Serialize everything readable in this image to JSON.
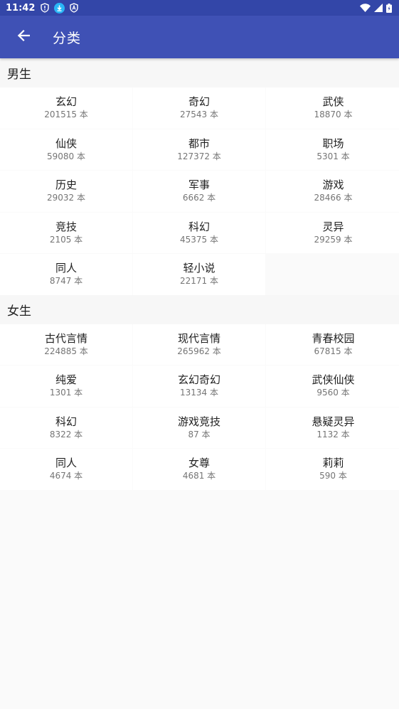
{
  "status_bar": {
    "time": "11:42",
    "left_icons": [
      "shield-alert-icon",
      "download-icon",
      "shield-a-icon"
    ],
    "right_icons": [
      "wifi-icon",
      "signal-icon",
      "battery-icon"
    ]
  },
  "app_bar": {
    "title": "分类",
    "back_icon": "arrow-left-icon",
    "color": "#3f51b5"
  },
  "sections": [
    {
      "title": "男生",
      "items": [
        {
          "name": "玄幻",
          "count": "201515 本"
        },
        {
          "name": "奇幻",
          "count": "27543 本"
        },
        {
          "name": "武侠",
          "count": "18870 本"
        },
        {
          "name": "仙侠",
          "count": "59080 本"
        },
        {
          "name": "都市",
          "count": "127372 本"
        },
        {
          "name": "职场",
          "count": "5301 本"
        },
        {
          "name": "历史",
          "count": "29032 本"
        },
        {
          "name": "军事",
          "count": "6662 本"
        },
        {
          "name": "游戏",
          "count": "28466 本"
        },
        {
          "name": "竞技",
          "count": "2105 本"
        },
        {
          "name": "科幻",
          "count": "45375 本"
        },
        {
          "name": "灵异",
          "count": "29259 本"
        },
        {
          "name": "同人",
          "count": "8747 本"
        },
        {
          "name": "轻小说",
          "count": "22171 本"
        }
      ]
    },
    {
      "title": "女生",
      "items": [
        {
          "name": "古代言情",
          "count": "224885 本"
        },
        {
          "name": "现代言情",
          "count": "265962 本"
        },
        {
          "name": "青春校园",
          "count": "67815 本"
        },
        {
          "name": "纯爱",
          "count": "1301 本"
        },
        {
          "name": "玄幻奇幻",
          "count": "13134 本"
        },
        {
          "name": "武侠仙侠",
          "count": "9560 本"
        },
        {
          "name": "科幻",
          "count": "8322 本"
        },
        {
          "name": "游戏竞技",
          "count": "87 本"
        },
        {
          "name": "悬疑灵异",
          "count": "1132 本"
        },
        {
          "name": "同人",
          "count": "4674 本"
        },
        {
          "name": "女尊",
          "count": "4681 本"
        },
        {
          "name": "莉莉",
          "count": "590 本"
        }
      ]
    }
  ]
}
